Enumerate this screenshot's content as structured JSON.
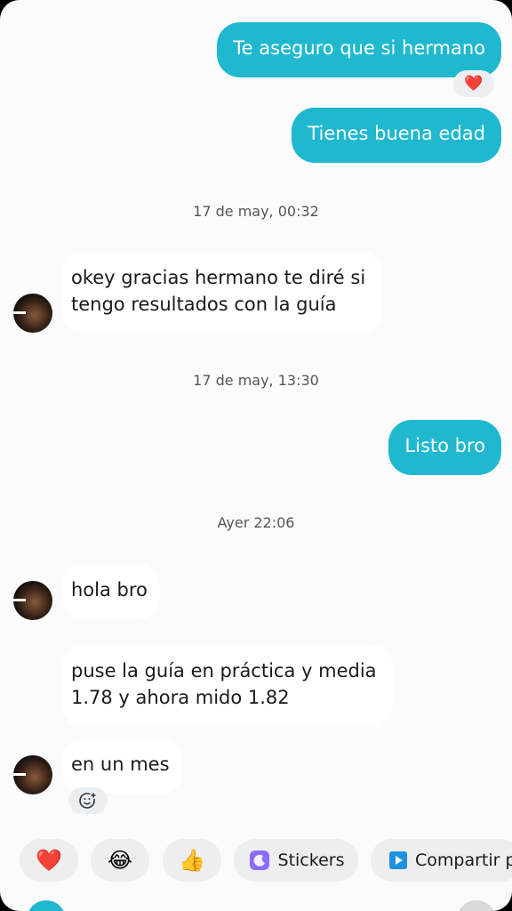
{
  "messages": {
    "out1": "Te aseguro que si hermano",
    "out1_reaction": "❤️",
    "out2": "Tienes buena edad",
    "ts1": "17 de may, 00:32",
    "in1_line1": "okey gracias hermano te diré si",
    "in1_line2": "tengo resultados con la guía",
    "ts2": "17 de may, 13:30",
    "out3": "Listo bro",
    "ts3": "Ayer 22:06",
    "in2": "hola bro",
    "in3_line1": "puse la guía en práctica y media",
    "in3_line2": "1.78 y ahora mido 1.82",
    "in4": "en un mes"
  },
  "quick_replies": {
    "heart": "❤️",
    "laugh": "😂",
    "thumbs": "👍",
    "stickers_label": "Stickers",
    "share_label": "Compartir p"
  },
  "icons": {
    "add_reaction": "smiley-plus-icon",
    "stickers": "sticker-icon",
    "share": "play-square-icon"
  },
  "colors": {
    "outgoing_bubble": "#1fb8cf",
    "incoming_bubble": "#ffffff",
    "background": "#fbfbfb",
    "accent_purple": "#8b6cf6",
    "accent_blue": "#1f8fe0"
  }
}
